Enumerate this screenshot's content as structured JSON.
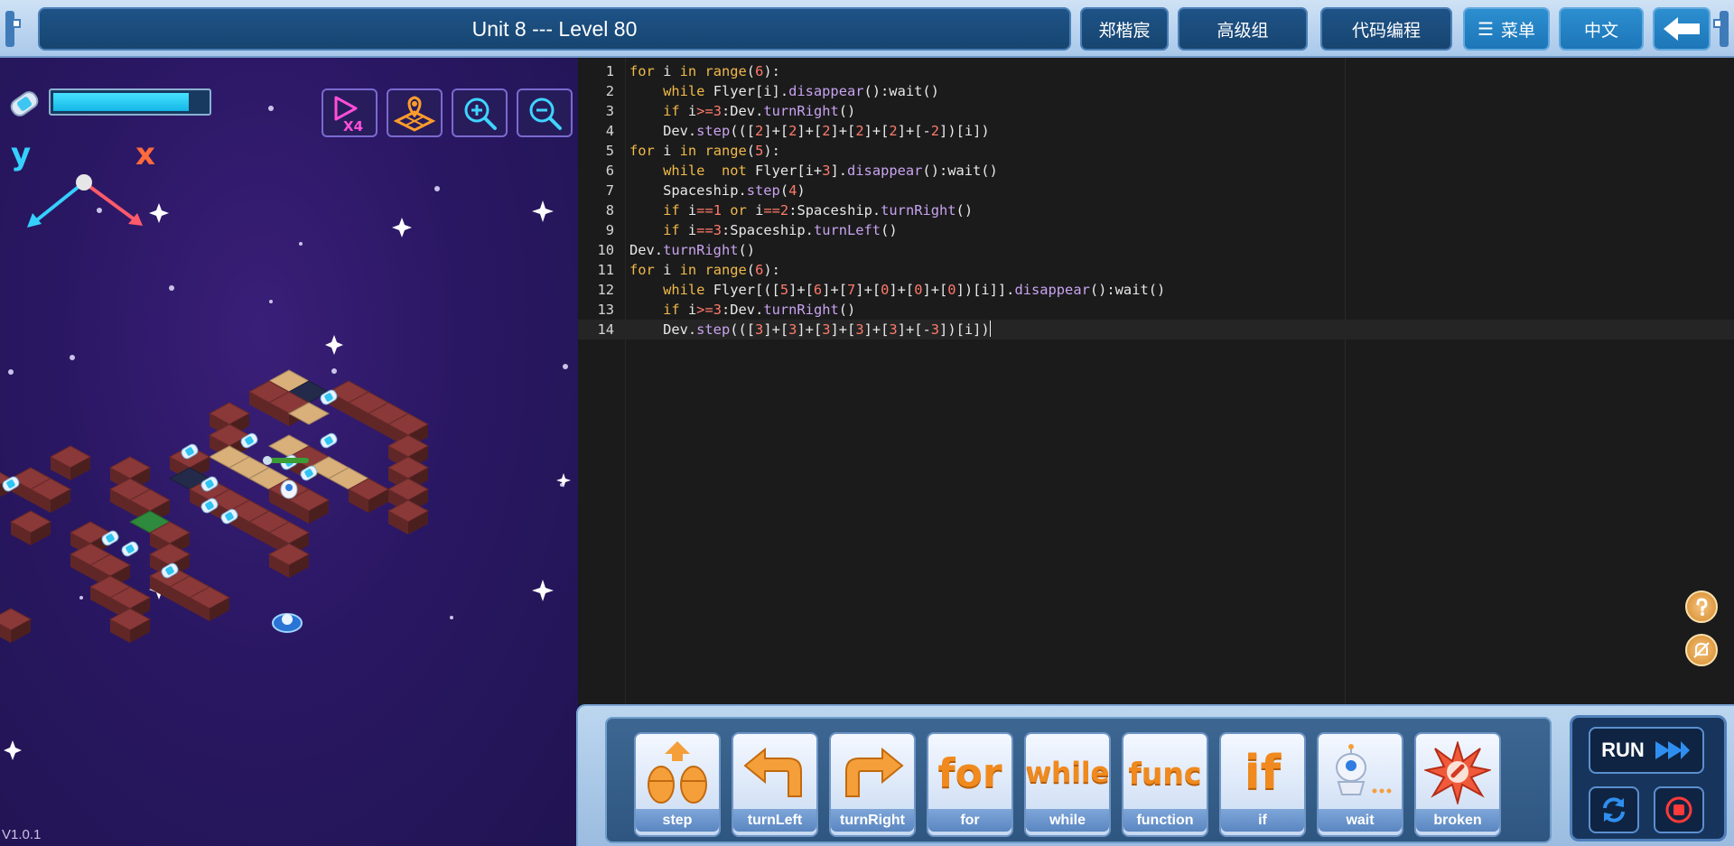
{
  "header": {
    "level_title": "Unit 8 --- Level 80",
    "user_name": "郑楷宸",
    "group_label": "高级组",
    "mode_label": "代码编程",
    "menu_label": "菜单",
    "language_label": "中文",
    "menu_icon": "list-icon",
    "back_icon": "arrow-left-icon"
  },
  "game": {
    "energy_level": 0.88,
    "speed_button": "X4",
    "axis_labels": {
      "y": "y",
      "x": "x"
    },
    "version": "V1.0.1",
    "colors": {
      "background": "#2a1763",
      "tile_red": "#8a3838",
      "tile_sand": "#d9b07a",
      "tile_green": "#2e8a3c",
      "energy": "#31c9f5"
    }
  },
  "editor": {
    "lines": [
      {
        "num": "1",
        "text": "for i in range(6):"
      },
      {
        "num": "2",
        "text": "    while Flyer[i].disappear():wait()"
      },
      {
        "num": "3",
        "text": "    if i>=3:Dev.turnRight()"
      },
      {
        "num": "4",
        "text": "    Dev.step(([2]+[2]+[2]+[2]+[2]+[-2])[i])"
      },
      {
        "num": "5",
        "text": "for i in range(5):"
      },
      {
        "num": "6",
        "text": "    while  not Flyer[i+3].disappear():wait()"
      },
      {
        "num": "7",
        "text": "    Spaceship.step(4)"
      },
      {
        "num": "8",
        "text": "    if i==1 or i==2:Spaceship.turnRight()"
      },
      {
        "num": "9",
        "text": "    if i==3:Spaceship.turnLeft()"
      },
      {
        "num": "10",
        "text": "Dev.turnRight()"
      },
      {
        "num": "11",
        "text": "for i in range(6):"
      },
      {
        "num": "12",
        "text": "    while Flyer[([5]+[6]+[7]+[0]+[0]+[0])[i]].disappear():wait()"
      },
      {
        "num": "13",
        "text": "    if i>=3:Dev.turnRight()"
      },
      {
        "num": "14",
        "text": "    Dev.step(([3]+[3]+[3]+[3]+[3]+[-3])[i])"
      }
    ],
    "active_line": 14,
    "syntax_colors": {
      "keyword": "#f0b94a",
      "number": "#ff7b6b",
      "method": "#c8a3f0",
      "text": "#e8e8e8"
    }
  },
  "toolbox": {
    "tools": [
      {
        "id": "step",
        "label": "step",
        "icon": "step-footprints-icon"
      },
      {
        "id": "turnLeft",
        "label": "turnLeft",
        "icon": "turn-left-arrow-icon"
      },
      {
        "id": "turnRight",
        "label": "turnRight",
        "icon": "turn-right-arrow-icon"
      },
      {
        "id": "for",
        "label": "for",
        "word": "for"
      },
      {
        "id": "while",
        "label": "while",
        "word": "while"
      },
      {
        "id": "function",
        "label": "function",
        "word": "func"
      },
      {
        "id": "if",
        "label": "if",
        "word": "if"
      },
      {
        "id": "wait",
        "label": "wait",
        "icon": "robot-waiting-icon"
      },
      {
        "id": "broken",
        "label": "broken",
        "icon": "explosion-icon"
      }
    ],
    "run_label": "RUN"
  }
}
